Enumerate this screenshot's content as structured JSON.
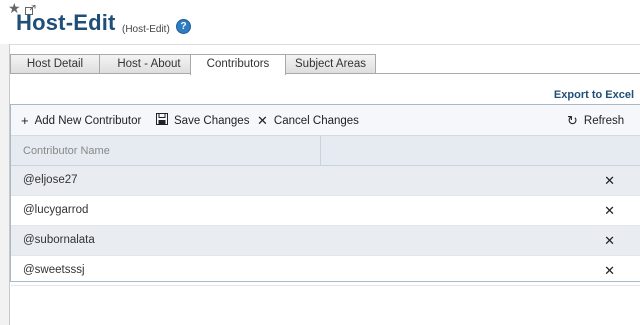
{
  "header": {
    "title": "Host-Edit",
    "subtitle": "(Host-Edit)",
    "help_glyph": "?"
  },
  "tabs": [
    {
      "label": "Host Detail",
      "active": false
    },
    {
      "label": "Host - About",
      "active": false
    },
    {
      "label": "Contributors",
      "active": true
    },
    {
      "label": "Subject Areas",
      "active": false
    }
  ],
  "export_label": "Export to Excel",
  "toolbar": {
    "add_label": "Add New Contributor",
    "save_label": "Save Changes",
    "cancel_label": "Cancel Changes",
    "refresh_label": "Refresh"
  },
  "grid": {
    "column_header": "Contributor Name",
    "rows": [
      "@eljose27",
      "@lucygarrod",
      "@subornalata",
      "@sweetsssj"
    ],
    "delete_glyph": "✕"
  },
  "colors": {
    "title": "#1f4e79",
    "accent": "#2f7cc0",
    "alt_row": "#e9edf2"
  }
}
